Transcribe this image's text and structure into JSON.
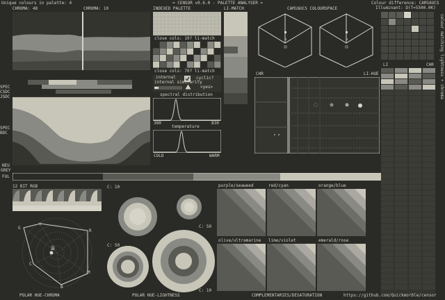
{
  "header": {
    "unique_colours": "Unique colours in palette: 4",
    "app_title": "= CENSOR v0.6.0 - PALETTE ANALYSER =",
    "colour_difference": "Colour difference: CAM16UCS",
    "illuminant": "Illuminant: D(T=5500.0K)"
  },
  "labels": {
    "chroma_48": "CHROMA: 48",
    "chroma_10": "CHROMA: 10",
    "indexed_palette": "INDEXED PALETTE",
    "li_match": "LI-MATCH",
    "cam16ucs": "CAM16UCS COLOURSPACE",
    "spec_left_1": "SPEC",
    "spec_left_2": "CSDC",
    "spec_left_3": "JSDC",
    "spec_mid_1": "SPEC",
    "spec_mid_2": "BDC",
    "neu": "NEU",
    "grey": "GREY",
    "ful": "FUL",
    "close_cols_top": "close cols: 10? li-match",
    "close_cols_bottom": "close cols: 70? li-match",
    "internal_similarity": "internal similarity",
    "cyclic": "cyclic?",
    "yes": "<yes>",
    "spectral_distribution": "spectral distribution",
    "spectral_min": "380",
    "spectral_max": "830",
    "temperature": "temperature",
    "cold": "COLD",
    "warm": "WARM",
    "chr_left": "CHR",
    "li_hue": "LI-HUE",
    "li": "LI",
    "chr_right": "CHR",
    "rgb12": "12 BIT RGB",
    "c10_a": "C: 10",
    "c50_a": "C: 50",
    "c50_b": "C: 50",
    "c10_b": "C: 10",
    "polar_hue_chroma": "POLAR HUE-CHROMA",
    "polar_hue_lightness": "POLAR HUE-LIGHTNESS",
    "complementaries": "COMPLEMENTARIES/DESATURATION",
    "github": "https://github.com/Quickmorble/censor",
    "right_vertical": "colour matching lightness + chroma",
    "polar_G": "G",
    "polar_Y": "Y",
    "polar_R": "R",
    "polar_C": "C",
    "polar_M": "M",
    "polar_B": "B"
  },
  "complementary_pairs": [
    "purple/seaweed",
    "red/cyan",
    "orange/blue",
    "olive/ultramarine",
    "lime/violet",
    "emerald/rose"
  ],
  "palette": [
    "#2a2a27",
    "#5a5a55",
    "#8a8a84",
    "#c8c6b8"
  ],
  "colors": {
    "background": "#2a2a27",
    "panel": "#34342f",
    "text": "#d6d4c8",
    "dark": "#2a2a27",
    "mid_dark": "#5a5a55",
    "mid_light": "#8a8a84",
    "light": "#c8c6b8"
  },
  "icons": [
    "checkbox-checked-icon",
    "triangle-warning-icon"
  ]
}
